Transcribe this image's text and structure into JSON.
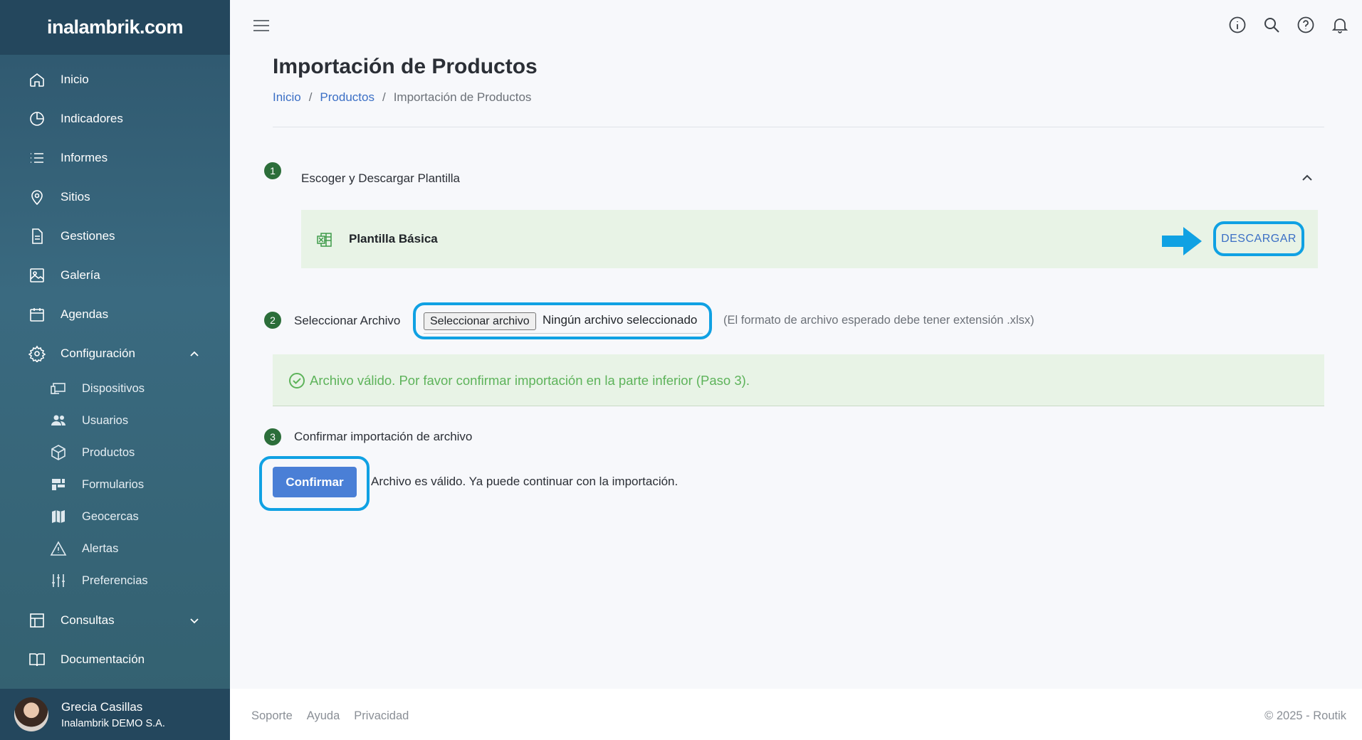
{
  "app": {
    "logo_text": "inalambrik.com"
  },
  "sidebar": {
    "items": [
      {
        "label": "Inicio",
        "icon": "home-icon"
      },
      {
        "label": "Indicadores",
        "icon": "pie-chart-icon"
      },
      {
        "label": "Informes",
        "icon": "list-icon"
      },
      {
        "label": "Sitios",
        "icon": "map-pin-icon"
      },
      {
        "label": "Gestiones",
        "icon": "document-icon"
      },
      {
        "label": "Galería",
        "icon": "image-icon"
      },
      {
        "label": "Agendas",
        "icon": "calendar-icon"
      },
      {
        "label": "Configuración",
        "icon": "gear-icon",
        "expanded": true
      },
      {
        "label": "Consultas",
        "icon": "table-icon",
        "expanded": false
      },
      {
        "label": "Documentación",
        "icon": "book-icon"
      }
    ],
    "config_sub": [
      {
        "label": "Dispositivos",
        "icon": "devices-icon"
      },
      {
        "label": "Usuarios",
        "icon": "users-icon"
      },
      {
        "label": "Productos",
        "icon": "box-icon"
      },
      {
        "label": "Formularios",
        "icon": "form-icon"
      },
      {
        "label": "Geocercas",
        "icon": "map-icon"
      },
      {
        "label": "Alertas",
        "icon": "warning-icon"
      },
      {
        "label": "Preferencias",
        "icon": "sliders-icon"
      }
    ]
  },
  "user": {
    "name": "Grecia Casillas",
    "org": "Inalambrik DEMO S.A."
  },
  "page": {
    "title": "Importación de Productos",
    "breadcrumb": [
      "Inicio",
      "Productos",
      "Importación de Productos"
    ]
  },
  "step1": {
    "number": "1",
    "label": "Escoger y Descargar Plantilla",
    "template_name": "Plantilla Básica",
    "download_label": "DESCARGAR"
  },
  "step2": {
    "number": "2",
    "label": "Seleccionar Archivo",
    "file_button": "Seleccionar archivo",
    "file_status": "Ningún archivo seleccionado",
    "hint": "(El formato de archivo esperado debe tener extensión .xlsx)",
    "alert": "Archivo válido. Por favor confirmar importación en la parte inferior (Paso 3)."
  },
  "step3": {
    "number": "3",
    "label": "Confirmar importación de archivo",
    "confirm_label": "Confirmar",
    "message": "Archivo es válido. Ya puede continuar con la importación."
  },
  "footer": {
    "links": [
      "Soporte",
      "Ayuda",
      "Privacidad"
    ],
    "copyright": "© 2025 - Routik"
  },
  "colors": {
    "sidebar": "#2e566d",
    "accent": "#4a7fd6",
    "highlight": "#10a1e3",
    "success": "#5db35a",
    "step_badge": "#2c6e3a"
  }
}
